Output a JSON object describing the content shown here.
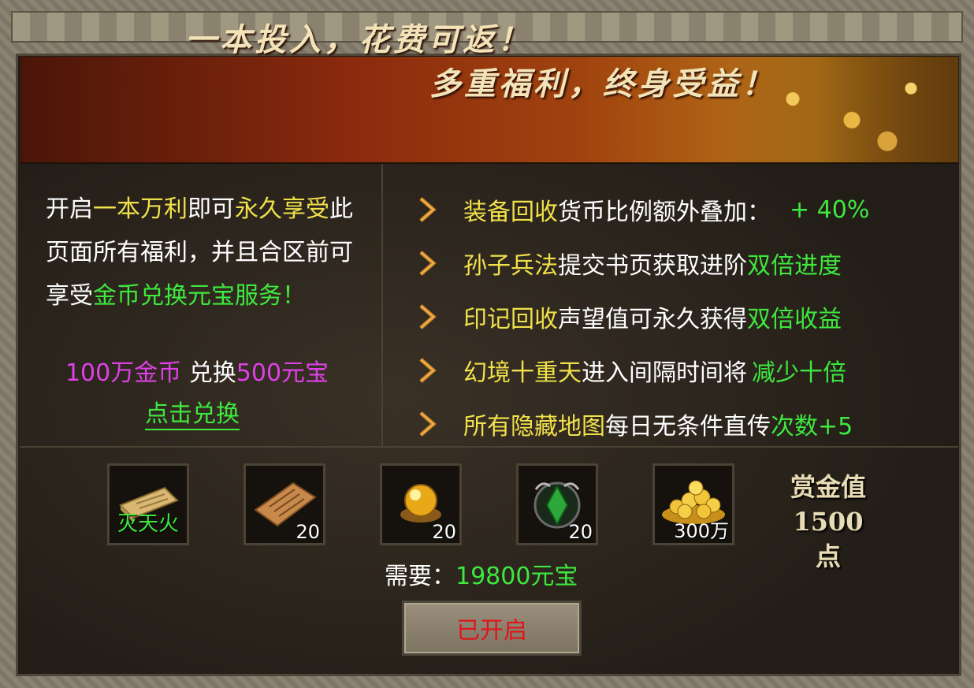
{
  "banner": {
    "line1": "一本投入，花费可返！",
    "line2": "多重福利，终身受益！"
  },
  "left": {
    "desc_segments": [
      {
        "text": "开启",
        "color": "white"
      },
      {
        "text": "一本万利",
        "color": "yellow"
      },
      {
        "text": "即可",
        "color": "white"
      },
      {
        "text": "永久享受",
        "color": "yellow"
      },
      {
        "text": "此页面所有福利，并且合区前可享受",
        "color": "white"
      },
      {
        "text": "金币兑换元宝服务",
        "color": "green"
      },
      {
        "text": "！",
        "color": "green"
      }
    ],
    "exchange": {
      "from": "100万金币",
      "verb": " 兑换",
      "to": "500元宝"
    },
    "click_label": "点击兑换"
  },
  "benefits": [
    {
      "highlight": "装备回收",
      "text": "货币比例额外叠加：",
      "value": " + 40%"
    },
    {
      "highlight": "孙子兵法",
      "text": "提交书页获取进阶",
      "value": "双倍进度"
    },
    {
      "highlight": "印记回收",
      "text": "声望值可永久获得",
      "value": "双倍收益"
    },
    {
      "highlight": "幻境十重天",
      "text": "进入间隔时间将",
      "value": "减少十倍"
    },
    {
      "highlight": "所有隐藏地图",
      "text": "每日无条件直传",
      "value": " 次数+5"
    }
  ],
  "items": [
    {
      "name": "灭天火",
      "icon": "scroll-icon",
      "count": ""
    },
    {
      "name": "",
      "icon": "parchment-icon",
      "count": "20"
    },
    {
      "name": "",
      "icon": "golden-orb-icon",
      "count": "20"
    },
    {
      "name": "",
      "icon": "green-gem-icon",
      "count": "20"
    },
    {
      "name": "",
      "icon": "gold-coins-icon",
      "count": "300万"
    }
  ],
  "reward": {
    "line1": "赏金值",
    "line2": "1500点"
  },
  "need": {
    "label": "需要：",
    "value": "19800元宝"
  },
  "button": {
    "label": "已开启"
  },
  "colors": {
    "yellow": "#f0e14a",
    "green": "#3ee83e",
    "magenta": "#e040e8",
    "red": "#e0141a"
  }
}
